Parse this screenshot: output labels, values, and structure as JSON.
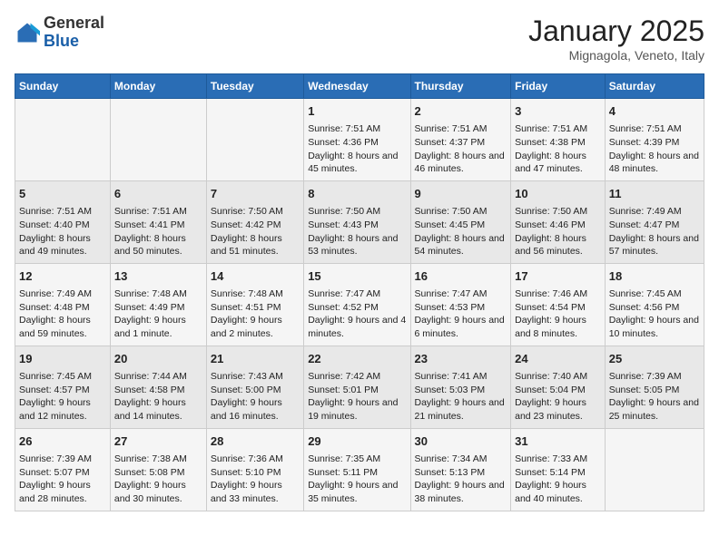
{
  "logo": {
    "general": "General",
    "blue": "Blue"
  },
  "title": "January 2025",
  "location": "Mignagola, Veneto, Italy",
  "headers": [
    "Sunday",
    "Monday",
    "Tuesday",
    "Wednesday",
    "Thursday",
    "Friday",
    "Saturday"
  ],
  "weeks": [
    [
      {
        "day": "",
        "sunrise": "",
        "sunset": "",
        "daylight": ""
      },
      {
        "day": "",
        "sunrise": "",
        "sunset": "",
        "daylight": ""
      },
      {
        "day": "",
        "sunrise": "",
        "sunset": "",
        "daylight": ""
      },
      {
        "day": "1",
        "sunrise": "Sunrise: 7:51 AM",
        "sunset": "Sunset: 4:36 PM",
        "daylight": "Daylight: 8 hours and 45 minutes."
      },
      {
        "day": "2",
        "sunrise": "Sunrise: 7:51 AM",
        "sunset": "Sunset: 4:37 PM",
        "daylight": "Daylight: 8 hours and 46 minutes."
      },
      {
        "day": "3",
        "sunrise": "Sunrise: 7:51 AM",
        "sunset": "Sunset: 4:38 PM",
        "daylight": "Daylight: 8 hours and 47 minutes."
      },
      {
        "day": "4",
        "sunrise": "Sunrise: 7:51 AM",
        "sunset": "Sunset: 4:39 PM",
        "daylight": "Daylight: 8 hours and 48 minutes."
      }
    ],
    [
      {
        "day": "5",
        "sunrise": "Sunrise: 7:51 AM",
        "sunset": "Sunset: 4:40 PM",
        "daylight": "Daylight: 8 hours and 49 minutes."
      },
      {
        "day": "6",
        "sunrise": "Sunrise: 7:51 AM",
        "sunset": "Sunset: 4:41 PM",
        "daylight": "Daylight: 8 hours and 50 minutes."
      },
      {
        "day": "7",
        "sunrise": "Sunrise: 7:50 AM",
        "sunset": "Sunset: 4:42 PM",
        "daylight": "Daylight: 8 hours and 51 minutes."
      },
      {
        "day": "8",
        "sunrise": "Sunrise: 7:50 AM",
        "sunset": "Sunset: 4:43 PM",
        "daylight": "Daylight: 8 hours and 53 minutes."
      },
      {
        "day": "9",
        "sunrise": "Sunrise: 7:50 AM",
        "sunset": "Sunset: 4:45 PM",
        "daylight": "Daylight: 8 hours and 54 minutes."
      },
      {
        "day": "10",
        "sunrise": "Sunrise: 7:50 AM",
        "sunset": "Sunset: 4:46 PM",
        "daylight": "Daylight: 8 hours and 56 minutes."
      },
      {
        "day": "11",
        "sunrise": "Sunrise: 7:49 AM",
        "sunset": "Sunset: 4:47 PM",
        "daylight": "Daylight: 8 hours and 57 minutes."
      }
    ],
    [
      {
        "day": "12",
        "sunrise": "Sunrise: 7:49 AM",
        "sunset": "Sunset: 4:48 PM",
        "daylight": "Daylight: 8 hours and 59 minutes."
      },
      {
        "day": "13",
        "sunrise": "Sunrise: 7:48 AM",
        "sunset": "Sunset: 4:49 PM",
        "daylight": "Daylight: 9 hours and 1 minute."
      },
      {
        "day": "14",
        "sunrise": "Sunrise: 7:48 AM",
        "sunset": "Sunset: 4:51 PM",
        "daylight": "Daylight: 9 hours and 2 minutes."
      },
      {
        "day": "15",
        "sunrise": "Sunrise: 7:47 AM",
        "sunset": "Sunset: 4:52 PM",
        "daylight": "Daylight: 9 hours and 4 minutes."
      },
      {
        "day": "16",
        "sunrise": "Sunrise: 7:47 AM",
        "sunset": "Sunset: 4:53 PM",
        "daylight": "Daylight: 9 hours and 6 minutes."
      },
      {
        "day": "17",
        "sunrise": "Sunrise: 7:46 AM",
        "sunset": "Sunset: 4:54 PM",
        "daylight": "Daylight: 9 hours and 8 minutes."
      },
      {
        "day": "18",
        "sunrise": "Sunrise: 7:45 AM",
        "sunset": "Sunset: 4:56 PM",
        "daylight": "Daylight: 9 hours and 10 minutes."
      }
    ],
    [
      {
        "day": "19",
        "sunrise": "Sunrise: 7:45 AM",
        "sunset": "Sunset: 4:57 PM",
        "daylight": "Daylight: 9 hours and 12 minutes."
      },
      {
        "day": "20",
        "sunrise": "Sunrise: 7:44 AM",
        "sunset": "Sunset: 4:58 PM",
        "daylight": "Daylight: 9 hours and 14 minutes."
      },
      {
        "day": "21",
        "sunrise": "Sunrise: 7:43 AM",
        "sunset": "Sunset: 5:00 PM",
        "daylight": "Daylight: 9 hours and 16 minutes."
      },
      {
        "day": "22",
        "sunrise": "Sunrise: 7:42 AM",
        "sunset": "Sunset: 5:01 PM",
        "daylight": "Daylight: 9 hours and 19 minutes."
      },
      {
        "day": "23",
        "sunrise": "Sunrise: 7:41 AM",
        "sunset": "Sunset: 5:03 PM",
        "daylight": "Daylight: 9 hours and 21 minutes."
      },
      {
        "day": "24",
        "sunrise": "Sunrise: 7:40 AM",
        "sunset": "Sunset: 5:04 PM",
        "daylight": "Daylight: 9 hours and 23 minutes."
      },
      {
        "day": "25",
        "sunrise": "Sunrise: 7:39 AM",
        "sunset": "Sunset: 5:05 PM",
        "daylight": "Daylight: 9 hours and 25 minutes."
      }
    ],
    [
      {
        "day": "26",
        "sunrise": "Sunrise: 7:39 AM",
        "sunset": "Sunset: 5:07 PM",
        "daylight": "Daylight: 9 hours and 28 minutes."
      },
      {
        "day": "27",
        "sunrise": "Sunrise: 7:38 AM",
        "sunset": "Sunset: 5:08 PM",
        "daylight": "Daylight: 9 hours and 30 minutes."
      },
      {
        "day": "28",
        "sunrise": "Sunrise: 7:36 AM",
        "sunset": "Sunset: 5:10 PM",
        "daylight": "Daylight: 9 hours and 33 minutes."
      },
      {
        "day": "29",
        "sunrise": "Sunrise: 7:35 AM",
        "sunset": "Sunset: 5:11 PM",
        "daylight": "Daylight: 9 hours and 35 minutes."
      },
      {
        "day": "30",
        "sunrise": "Sunrise: 7:34 AM",
        "sunset": "Sunset: 5:13 PM",
        "daylight": "Daylight: 9 hours and 38 minutes."
      },
      {
        "day": "31",
        "sunrise": "Sunrise: 7:33 AM",
        "sunset": "Sunset: 5:14 PM",
        "daylight": "Daylight: 9 hours and 40 minutes."
      },
      {
        "day": "",
        "sunrise": "",
        "sunset": "",
        "daylight": ""
      }
    ]
  ]
}
